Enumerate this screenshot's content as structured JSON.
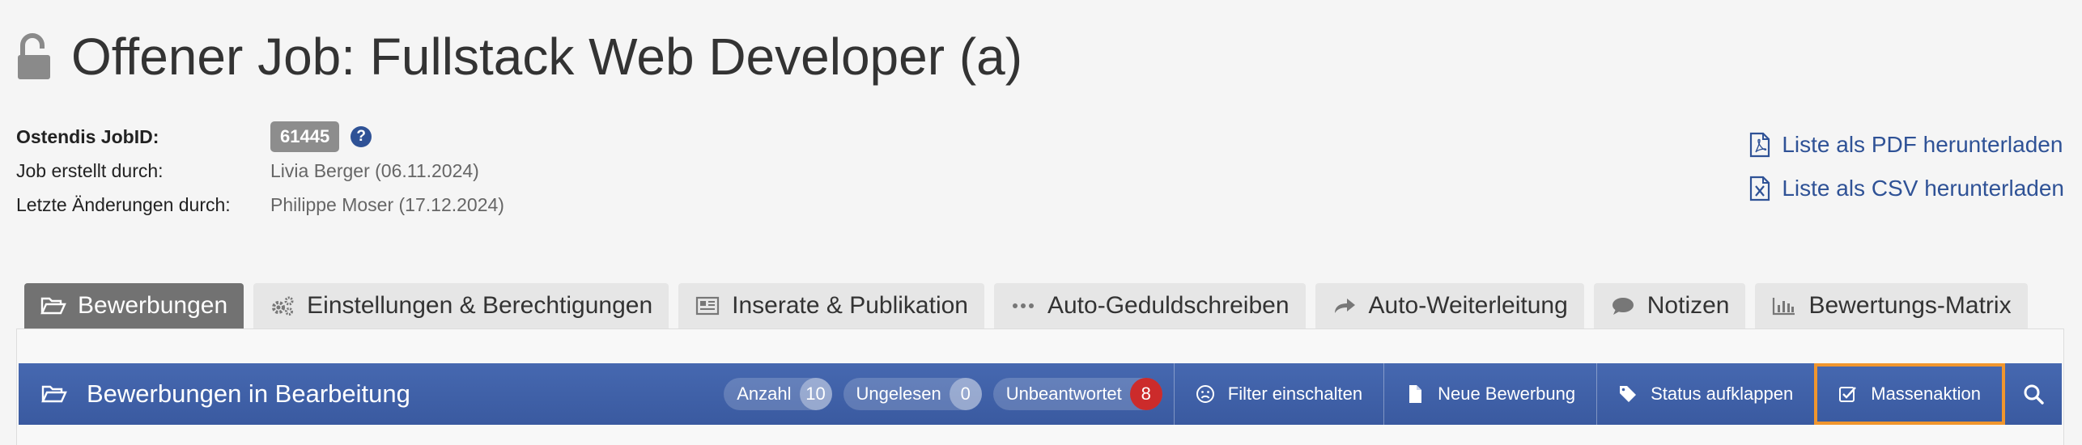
{
  "header": {
    "title": "Offener Job: Fullstack Web Developer (a)",
    "lock_icon": "unlock-icon"
  },
  "meta": {
    "jobid_label": "Ostendis JobID:",
    "jobid_value": "61445",
    "help_symbol": "?",
    "created_label": "Job erstellt durch:",
    "created_value": "Livia Berger (06.11.2024)",
    "changed_label": "Letzte Änderungen durch:",
    "changed_value": "Philippe Moser (17.12.2024)"
  },
  "downloads": {
    "pdf_label": "Liste als PDF herunterladen",
    "csv_label": "Liste als CSV herunterladen"
  },
  "tabs": [
    {
      "label": "Bewerbungen",
      "icon": "folder-open-icon",
      "active": true
    },
    {
      "label": "Einstellungen & Berechtigungen",
      "icon": "cogs-icon"
    },
    {
      "label": "Inserate & Publikation",
      "icon": "newspaper-icon"
    },
    {
      "label": "Auto-Geduldschreiben",
      "icon": "ellipsis-icon"
    },
    {
      "label": "Auto-Weiterleitung",
      "icon": "share-icon"
    },
    {
      "label": "Notizen",
      "icon": "comment-icon"
    },
    {
      "label": "Bewertungs-Matrix",
      "icon": "bar-chart-icon"
    }
  ],
  "panel": {
    "title": "Bewerbungen in Bearbeitung",
    "counters": [
      {
        "label": "Anzahl",
        "value": "10"
      },
      {
        "label": "Ungelesen",
        "value": "0"
      },
      {
        "label": "Unbeantwortet",
        "value": "8"
      }
    ],
    "actions": {
      "filter": "Filter einschalten",
      "new": "Neue Bewerbung",
      "status": "Status aufklappen",
      "mass": "Massenaktion"
    }
  },
  "colors": {
    "accent": "#2f5296",
    "bar": "#3f61a8",
    "highlight": "#f0962e",
    "badge_red": "#cc2b2b"
  }
}
